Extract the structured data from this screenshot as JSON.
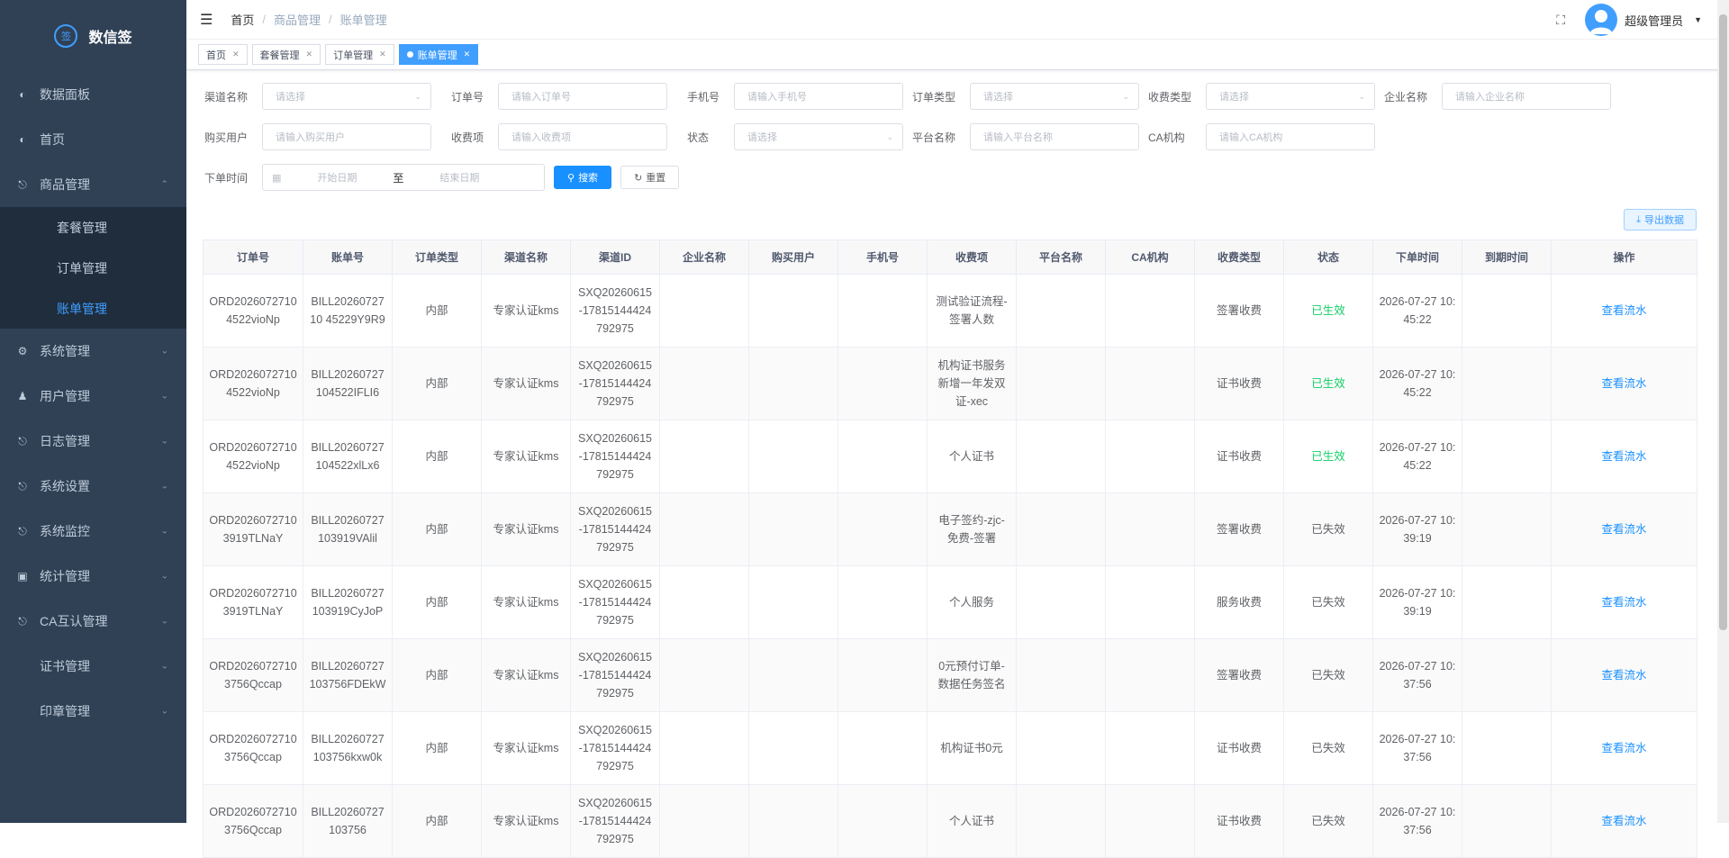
{
  "app": {
    "title": "数信签",
    "logo_mark": "签"
  },
  "sidebar": {
    "items": [
      {
        "label": "数据面板",
        "icon": "dashboard-icon"
      },
      {
        "label": "首页",
        "icon": "dashboard-icon"
      },
      {
        "label": "商品管理",
        "icon": "product-icon",
        "expanded": true,
        "children": [
          {
            "label": "套餐管理"
          },
          {
            "label": "订单管理"
          },
          {
            "label": "账单管理",
            "active": true
          }
        ]
      },
      {
        "label": "系统管理",
        "icon": "gear-icon"
      },
      {
        "label": "用户管理",
        "icon": "user-icon"
      },
      {
        "label": "日志管理",
        "icon": "product-icon"
      },
      {
        "label": "系统设置",
        "icon": "product-icon"
      },
      {
        "label": "系统监控",
        "icon": "product-icon"
      },
      {
        "label": "统计管理",
        "icon": "monitor-icon"
      },
      {
        "label": "CA互认管理",
        "icon": "product-icon"
      },
      {
        "label": "证书管理",
        "icon": ""
      },
      {
        "label": "印章管理",
        "icon": ""
      }
    ]
  },
  "header": {
    "breadcrumb": [
      "首页",
      "商品管理",
      "账单管理"
    ],
    "user_name": "超级管理员"
  },
  "tags": [
    {
      "label": "首页"
    },
    {
      "label": "套餐管理"
    },
    {
      "label": "订单管理"
    },
    {
      "label": "账单管理",
      "active": true
    }
  ],
  "filters": {
    "channel": {
      "label": "渠道名称",
      "placeholder": "请选择"
    },
    "order_no": {
      "label": "订单号",
      "placeholder": "请输入订单号"
    },
    "phone": {
      "label": "手机号",
      "placeholder": "请输入手机号"
    },
    "order_type": {
      "label": "订单类型",
      "placeholder": "请选择"
    },
    "fee_type": {
      "label": "收费类型",
      "placeholder": "请选择"
    },
    "company": {
      "label": "企业名称",
      "placeholder": "请输入企业名称"
    },
    "buyer": {
      "label": "购买用户",
      "placeholder": "请输入购买用户"
    },
    "fee_item": {
      "label": "收费项",
      "placeholder": "请输入收费项"
    },
    "status": {
      "label": "状态",
      "placeholder": "请选择"
    },
    "platform": {
      "label": "平台名称",
      "placeholder": "请输入平台名称"
    },
    "ca": {
      "label": "CA机构",
      "placeholder": "请输入CA机构"
    },
    "order_time": {
      "label": "下单时间",
      "start_placeholder": "开始日期",
      "separator": "至",
      "end_placeholder": "结束日期"
    },
    "search_label": "搜索",
    "reset_label": "重置",
    "export_label": "导出数据"
  },
  "table": {
    "columns": [
      "订单号",
      "账单号",
      "订单类型",
      "渠道名称",
      "渠道ID",
      "企业名称",
      "购买用户",
      "手机号",
      "收费项",
      "平台名称",
      "CA机构",
      "收费类型",
      "状态",
      "下单时间",
      "到期时间",
      "操作"
    ],
    "action_label": "查看流水",
    "rows": [
      {
        "order": "ORD20260727104522vioNp",
        "bill": "BILL2026072710 45229Y9R9",
        "type": "内部",
        "channel": "专家认证kms",
        "channel_id": "SXQ20260615-17815144424792975",
        "item": "测试验证流程-签署人数",
        "fee_type": "签署收费",
        "status": "已生效",
        "active": true,
        "time": "2026-07-27 10:45:22"
      },
      {
        "order": "ORD20260727104522vioNp",
        "bill": "BILL20260727104522IFLI6",
        "type": "内部",
        "channel": "专家认证kms",
        "channel_id": "SXQ20260615-17815144424792975",
        "item": "机构证书服务新增一年发双证-xec",
        "fee_type": "证书收费",
        "status": "已生效",
        "active": true,
        "time": "2026-07-27 10:45:22"
      },
      {
        "order": "ORD20260727104522vioNp",
        "bill": "BILL20260727104522xlLx6",
        "type": "内部",
        "channel": "专家认证kms",
        "channel_id": "SXQ20260615-17815144424792975",
        "item": "个人证书",
        "fee_type": "证书收费",
        "status": "已生效",
        "active": true,
        "time": "2026-07-27 10:45:22"
      },
      {
        "order": "ORD20260727103919TLNaY",
        "bill": "BILL20260727103919VAlil",
        "type": "内部",
        "channel": "专家认证kms",
        "channel_id": "SXQ20260615-17815144424792975",
        "item": "电子签约-zjc-免费-签署",
        "fee_type": "签署收费",
        "status": "已失效",
        "active": false,
        "time": "2026-07-27 10:39:19"
      },
      {
        "order": "ORD20260727103919TLNaY",
        "bill": "BILL20260727103919CyJoP",
        "type": "内部",
        "channel": "专家认证kms",
        "channel_id": "SXQ20260615-17815144424792975",
        "item": "个人服务",
        "fee_type": "服务收费",
        "status": "已失效",
        "active": false,
        "time": "2026-07-27 10:39:19"
      },
      {
        "order": "ORD20260727103756Qccap",
        "bill": "BILL20260727103756FDEkW",
        "type": "内部",
        "channel": "专家认证kms",
        "channel_id": "SXQ20260615-17815144424792975",
        "item": "0元预付订单-数据任务签名",
        "fee_type": "签署收费",
        "status": "已失效",
        "active": false,
        "time": "2026-07-27 10:37:56"
      },
      {
        "order": "ORD20260727103756Qccap",
        "bill": "BILL20260727103756kxw0k",
        "type": "内部",
        "channel": "专家认证kms",
        "channel_id": "SXQ20260615-17815144424792975",
        "item": "机构证书0元",
        "fee_type": "证书收费",
        "status": "已失效",
        "active": false,
        "time": "2026-07-27 10:37:56"
      },
      {
        "order": "ORD20260727103756Qccap",
        "bill": "BILL20260727103756",
        "type": "内部",
        "channel": "专家认证kms",
        "channel_id": "SXQ20260615-17815144424792975",
        "item": "个人证书",
        "fee_type": "证书收费",
        "status": "已失效",
        "active": false,
        "time": "2026-07-27 10:37:56"
      }
    ]
  },
  "colors": {
    "sidebar_bg": "#304156",
    "submenu_bg": "#1f2d3d",
    "accent": "#409eff",
    "active_status": "#13ce66"
  }
}
